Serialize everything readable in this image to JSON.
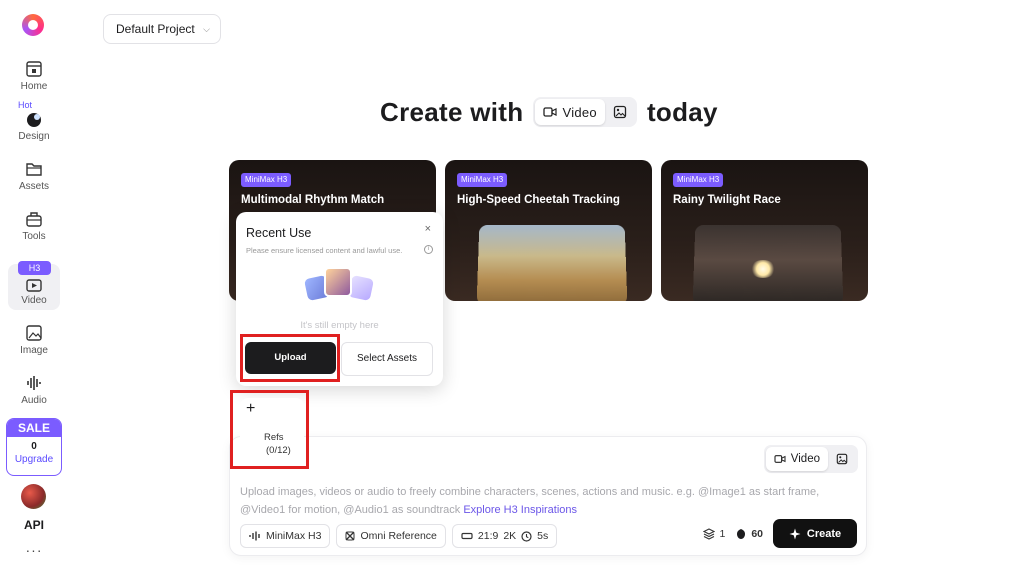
{
  "sidebar": {
    "items": [
      {
        "label": "Home",
        "icon": "home-icon"
      },
      {
        "label": "Design",
        "icon": "design-icon",
        "badge": "Hot"
      },
      {
        "label": "Assets",
        "icon": "folder-icon"
      },
      {
        "label": "Tools",
        "icon": "toolbox-icon"
      },
      {
        "label": "Video",
        "icon": "video-icon",
        "badge": "H3",
        "active": true
      },
      {
        "label": "Image",
        "icon": "image-icon"
      },
      {
        "label": "Audio",
        "icon": "audio-icon"
      }
    ],
    "sale": {
      "title": "SALE",
      "value": "0",
      "cta": "Upgrade"
    },
    "api_label": "API",
    "more": "···"
  },
  "header": {
    "project": "Default Project"
  },
  "hero": {
    "prefix": "Create with",
    "modes": [
      "Video"
    ],
    "suffix": "today"
  },
  "cards": [
    {
      "tag": "MiniMax H3",
      "title": "Multimodal Rhythm Match"
    },
    {
      "tag": "MiniMax H3",
      "title": "High-Speed Cheetah Tracking"
    },
    {
      "tag": "MiniMax H3",
      "title": "Rainy Twilight Race"
    }
  ],
  "popup": {
    "title": "Recent Use",
    "close": "×",
    "note": "Please ensure licensed content and lawful use.",
    "info": "i",
    "empty_text": "It's still empty here",
    "upload_label": "Upload",
    "assets_label": "Select Assets"
  },
  "refs": {
    "plus": "+",
    "label": "Refs",
    "count": "(0/12)"
  },
  "composer": {
    "mode_label": "Video",
    "prompt_text": "Upload images, videos or audio to freely combine characters, scenes, actions and music. e.g. @Image1 as start frame, @Video1 for motion, @Audio1 as soundtrack ",
    "prompt_link": "Explore H3 Inspirations",
    "chips": {
      "model": "MiniMax H3",
      "reference": "Omni Reference",
      "ratio": "21:9",
      "resolution": "2K",
      "duration": "5s"
    },
    "count": "1",
    "credits": "60",
    "create_label": "Create"
  },
  "colors": {
    "accent": "#7b5cff",
    "highlight": "#e02020",
    "primary_button": "#1c1c1e"
  }
}
